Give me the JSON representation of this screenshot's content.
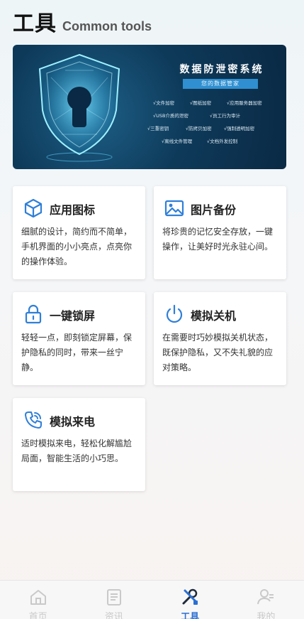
{
  "header": {
    "title": "工具",
    "subtitle": "Common tools"
  },
  "banner": {
    "title": "数据防泄密系统",
    "tag": "您的数据管家",
    "features": [
      "√文件加密",
      "√图纸加密",
      "√应用服务器加密",
      "√USB介质的泄密",
      "√员工行为审计",
      "√三重密钥",
      "√防拷贝加密",
      "√强制透明加密",
      "√离线文件管理",
      "√文档外发控制"
    ]
  },
  "cards": [
    {
      "icon": "cube-icon",
      "title": "应用图标",
      "desc": "细腻的设计，简约而不简单，手机界面的小小亮点，点亮你的操作体验。"
    },
    {
      "icon": "image-icon",
      "title": "图片备份",
      "desc": "将珍贵的记忆安全存放，一键操作，让美好时光永驻心间。"
    },
    {
      "icon": "lock-icon",
      "title": "一键锁屏",
      "desc": "轻轻一点，即刻锁定屏幕，保护隐私的同时，带来一丝宁静。"
    },
    {
      "icon": "power-icon",
      "title": "模拟关机",
      "desc": "在需要时巧妙模拟关机状态，既保护隐私，又不失礼貌的应对策略。"
    },
    {
      "icon": "phone-icon",
      "title": "模拟来电",
      "desc": "适时模拟来电，轻松化解尴尬局面，智能生活的小巧思。"
    }
  ],
  "tabbar": {
    "active": "工具",
    "items": [
      {
        "label": "首页",
        "icon": "home-icon"
      },
      {
        "label": "资讯",
        "icon": "document-icon"
      },
      {
        "label": "工具",
        "icon": "tools-icon"
      },
      {
        "label": "我的",
        "icon": "user-icon"
      }
    ]
  },
  "colors": {
    "accent": "#2b6fd3",
    "icon_blue": "#2f7fd8",
    "banner_bg": "#0e3a5a",
    "inactive": "#c9c9c9"
  }
}
